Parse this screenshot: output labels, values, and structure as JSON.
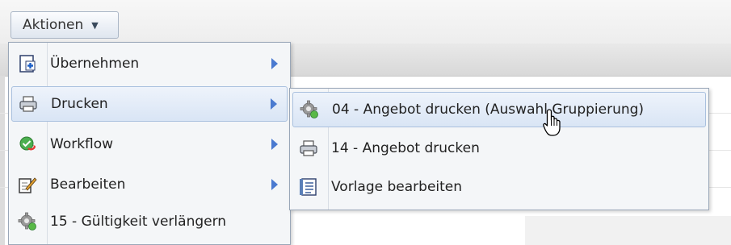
{
  "actions_button": {
    "label": "Aktionen",
    "arrow": "▼"
  },
  "main_menu": {
    "items": [
      {
        "label": "Übernehmen",
        "icon": "add-document-icon",
        "has_submenu": true
      },
      {
        "label": "Drucken",
        "icon": "printer-icon",
        "has_submenu": true,
        "active": true
      },
      {
        "label": "Workflow",
        "icon": "workflow-icon",
        "has_submenu": true
      },
      {
        "label": "Bearbeiten",
        "icon": "edit-document-icon",
        "has_submenu": true
      },
      {
        "label": "15 - Gültigkeit verlängern",
        "icon": "gear-icon",
        "has_submenu": false
      }
    ]
  },
  "submenu": {
    "items": [
      {
        "label": "04 - Angebot drucken (Auswahl Gruppierung)",
        "icon": "gear-icon",
        "hovered": true
      },
      {
        "label": "14 - Angebot drucken",
        "icon": "printer-icon"
      },
      {
        "label": "Vorlage bearbeiten",
        "icon": "template-icon"
      }
    ]
  },
  "colors": {
    "accent": "#4a7ad0",
    "menu_border": "#9aa7b8",
    "highlight": "#d9e5f5"
  }
}
